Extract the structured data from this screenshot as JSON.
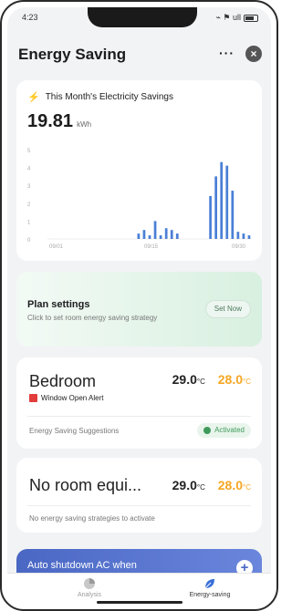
{
  "status": {
    "time": "4:23",
    "right": "⌁ ⚑ ull"
  },
  "header": {
    "title": "Energy Saving",
    "more_label": "···",
    "close_label": "×"
  },
  "savings": {
    "label": "This Month's Electricity Savings",
    "value": "19.81",
    "unit": "kWh"
  },
  "chart_data": {
    "type": "bar",
    "x": [
      "09/01",
      "09/15",
      "09/30"
    ],
    "values": [
      0,
      0,
      0,
      0,
      0,
      0,
      0,
      0,
      0,
      0,
      0,
      0,
      0,
      0,
      0,
      0,
      0.3,
      0.5,
      0.2,
      1.0,
      0.2,
      0.6,
      0.5,
      0.3,
      0,
      0,
      0,
      0,
      0,
      2.4,
      3.5,
      4.3,
      4.1,
      2.7,
      0.4,
      0.3,
      0.2
    ],
    "yticks": [
      "5",
      "4",
      "3",
      "2",
      "1",
      "0"
    ],
    "ylim": [
      0,
      5
    ],
    "color": "#4a7fd6"
  },
  "plan": {
    "title": "Plan settings",
    "subtitle": "Click to set room energy saving strategy",
    "button": "Set Now"
  },
  "rooms": [
    {
      "name": "Bedroom",
      "current_temp": "29.0",
      "set_temp": "28.0",
      "unit": "°C",
      "window_status": "Window Open Alert",
      "suggestion_label": "Energy Saving Suggestions",
      "status_badge": "Activated"
    },
    {
      "name": "No room equi...",
      "current_temp": "29.0",
      "set_temp": "28.0",
      "unit": "°C",
      "note": "No energy saving strategies to activate"
    }
  ],
  "auto": {
    "label": "Auto shutdown AC when",
    "plus": "+"
  },
  "tabs": [
    {
      "label": "Analysis",
      "icon": "pie-chart-icon"
    },
    {
      "label": "Energy-saving",
      "icon": "leaf-icon"
    }
  ],
  "colors": {
    "accent": "#f5a623",
    "green": "#3f9a5b",
    "blue": "#4a67c4"
  }
}
